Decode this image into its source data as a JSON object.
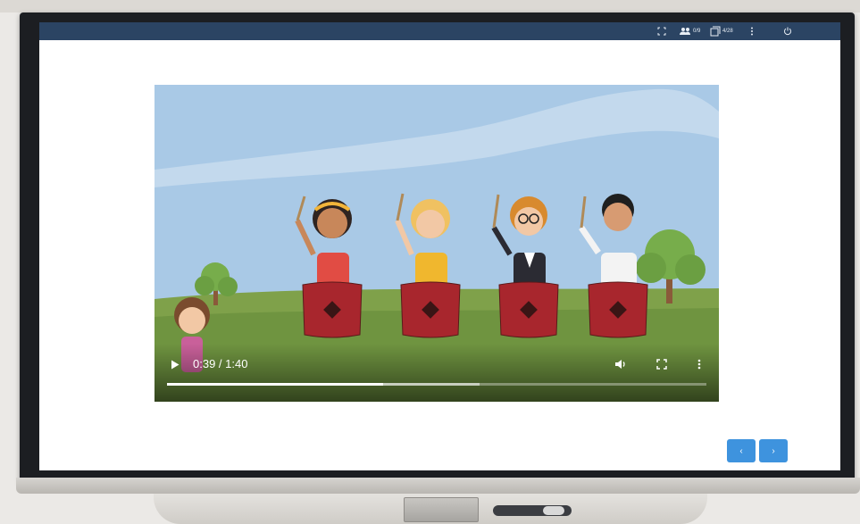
{
  "topbar": {
    "participants": "0/9",
    "pages": "4/28"
  },
  "video": {
    "time": "0:39 / 1:40",
    "progress": 0.4,
    "buffered": 0.58
  },
  "nav": {
    "prev": "‹",
    "next": "›"
  },
  "colors": {
    "topbar": "#2b4463",
    "nav_button": "#3e93de",
    "sky": "#a9c9e6",
    "grass": "#7fa14a"
  },
  "icons": [
    "fit-screen-icon",
    "participants-icon",
    "pages-icon",
    "more-icon",
    "power-icon",
    "play-icon",
    "volume-icon",
    "fullscreen-icon",
    "video-more-icon"
  ]
}
